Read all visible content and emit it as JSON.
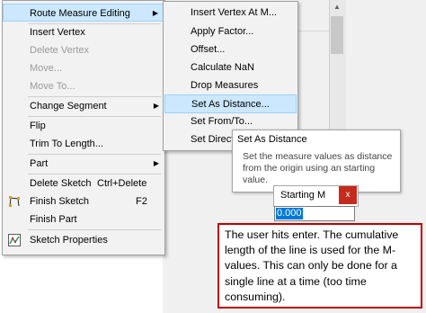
{
  "context_menu": {
    "items": [
      {
        "label": "Route Measure Editing",
        "highlighted": true,
        "submenu": true
      },
      {
        "label": "Insert Vertex"
      },
      {
        "label": "Delete Vertex",
        "disabled": true
      },
      {
        "label": "Move...",
        "disabled": true
      },
      {
        "label": "Move To...",
        "disabled": true
      },
      {
        "label": "Change Segment",
        "submenu": true
      },
      {
        "label": "Flip"
      },
      {
        "label": "Trim To Length..."
      },
      {
        "label": "Part",
        "submenu": true
      },
      {
        "label": "Delete Sketch",
        "shortcut": "Ctrl+Delete"
      },
      {
        "label": "Finish Sketch",
        "shortcut": "F2",
        "icon": "finish-sketch-icon"
      },
      {
        "label": "Finish Part"
      },
      {
        "label": "Sketch Properties",
        "icon": "sketch-properties-icon"
      }
    ]
  },
  "submenu": {
    "items": [
      {
        "label": "Insert Vertex At M..."
      },
      {
        "label": "Apply Factor..."
      },
      {
        "label": "Offset..."
      },
      {
        "label": "Calculate NaN"
      },
      {
        "label": "Drop Measures"
      },
      {
        "label": "Set As Distance...",
        "highlighted": true
      },
      {
        "label": "Set From/To..."
      },
      {
        "label": "Set Directi"
      }
    ]
  },
  "tooltip": {
    "title": "Set As Distance",
    "description": "Set the measure values as distance from the origin using an starting value."
  },
  "starting_m": {
    "title": "Starting M",
    "close_label": "x",
    "value": "0.000"
  },
  "note": {
    "text": "The user hits enter. The cumulative length of the line is used for the M-values. This can only be done for a single line at a time (too time consuming)."
  },
  "colors": {
    "highlight": "#cce8ff",
    "highlight_border": "#99d1ff",
    "close_button": "#c42b1c",
    "selection": "#0078d7",
    "note_border": "#c00000"
  }
}
